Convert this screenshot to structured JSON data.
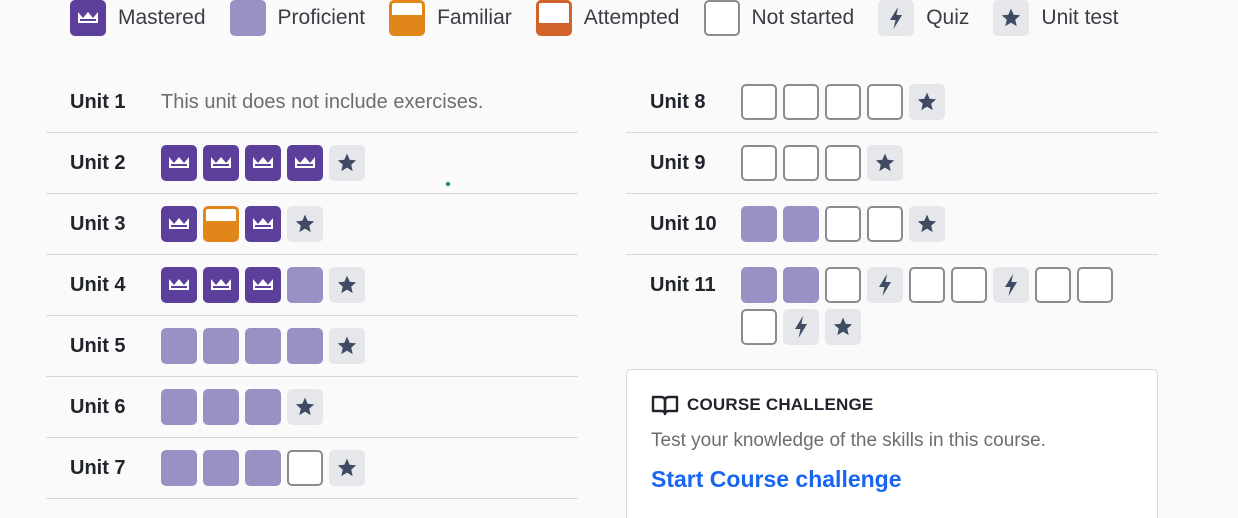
{
  "legend": [
    {
      "status": "mastered",
      "label": "Mastered",
      "icon": "crown-icon"
    },
    {
      "status": "proficient",
      "label": "Proficient"
    },
    {
      "status": "familiar",
      "label": "Familiar"
    },
    {
      "status": "attempted",
      "label": "Attempted"
    },
    {
      "status": "notstarted",
      "label": "Not started"
    },
    {
      "status": "quiz",
      "label": "Quiz",
      "icon": "lightning-icon"
    },
    {
      "status": "unittest",
      "label": "Unit test",
      "icon": "star-icon"
    }
  ],
  "colors": {
    "mastered": "#5c3f9a",
    "proficient": "#9990c4",
    "familiar": "#e0861a",
    "attempted": "#d1622a",
    "notstarted_border": "#8a8c92",
    "quiz_bg": "#e6e7ea",
    "icon": "#3f4a63",
    "link": "#1865f2"
  },
  "units_left": [
    {
      "name": "Unit 1",
      "note": "This unit does not include exercises.",
      "skills": []
    },
    {
      "name": "Unit 2",
      "skills": [
        "mastered",
        "mastered",
        "mastered",
        "mastered",
        "unittest"
      ]
    },
    {
      "name": "Unit 3",
      "skills": [
        "mastered",
        "familiar",
        "mastered",
        "unittest"
      ]
    },
    {
      "name": "Unit 4",
      "skills": [
        "mastered",
        "mastered",
        "mastered",
        "proficient",
        "unittest"
      ]
    },
    {
      "name": "Unit 5",
      "skills": [
        "proficient",
        "proficient",
        "proficient",
        "proficient",
        "unittest"
      ]
    },
    {
      "name": "Unit 6",
      "skills": [
        "proficient",
        "proficient",
        "proficient",
        "unittest"
      ]
    },
    {
      "name": "Unit 7",
      "skills": [
        "proficient",
        "proficient",
        "proficient",
        "notstarted",
        "unittest"
      ]
    }
  ],
  "units_right": [
    {
      "name": "Unit 8",
      "skills": [
        "notstarted",
        "notstarted",
        "notstarted",
        "notstarted",
        "unittest"
      ]
    },
    {
      "name": "Unit 9",
      "skills": [
        "notstarted",
        "notstarted",
        "notstarted",
        "unittest"
      ]
    },
    {
      "name": "Unit 10",
      "skills": [
        "proficient",
        "proficient",
        "notstarted",
        "notstarted",
        "unittest"
      ]
    },
    {
      "name": "Unit 11",
      "skills": [
        "proficient",
        "proficient",
        "notstarted",
        "quiz",
        "notstarted",
        "notstarted",
        "quiz",
        "notstarted",
        "notstarted",
        "notstarted",
        "quiz",
        "unittest"
      ]
    }
  ],
  "challenge": {
    "icon": "book-icon",
    "title": "COURSE CHALLENGE",
    "description": "Test your knowledge of the skills in this course.",
    "link_label": "Start Course challenge"
  }
}
